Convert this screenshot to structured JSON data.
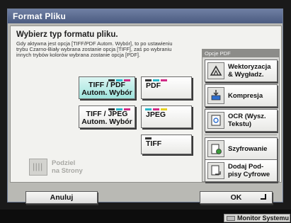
{
  "window": {
    "title": "Format Pliku"
  },
  "heading": "Wybierz typ formatu pliku.",
  "info_lines": [
    "Gdy aktywna jest opcja [TIFF/PDF Autom. Wybór], to po ustawieniu",
    "trybu Czarno-Biały wybrana zostanie opcja [TIFF], zaś po wybraniu",
    "innych trybów kolorów wybrana zostanie opcja [PDF]."
  ],
  "formats": {
    "tiff_pdf": {
      "line1": "TIFF / PDF",
      "line2": "Autom. Wybór",
      "selected": true
    },
    "pdf": {
      "label": "PDF"
    },
    "tiff_jpeg": {
      "line1": "TIFF / JPEG",
      "line2": "Autom. Wybór"
    },
    "jpeg": {
      "label": "JPEG"
    },
    "tiff": {
      "label": "TIFF"
    }
  },
  "split": {
    "line1": "Podziel",
    "line2": "na Strony",
    "enabled": false
  },
  "pdf_options": {
    "title": "Opcje PDF",
    "vector": {
      "line1": "Wektoryzacja",
      "line2": "& Wygładz.",
      "icon": "vectorize-icon"
    },
    "compress": {
      "label": "Kompresja",
      "icon": "compress-icon"
    },
    "ocr": {
      "line1": "OCR (Wysz.",
      "line2": "Tekstu)",
      "icon": "ocr-icon"
    },
    "encrypt": {
      "label": "Szyfrowanie",
      "icon": "encrypt-icon"
    },
    "signature": {
      "line1": "Dodaj Pod-",
      "line2": "pisy Cyfrowe",
      "icon": "signature-icon"
    }
  },
  "buttons": {
    "cancel": "Anuluj",
    "ok": "OK"
  },
  "status": {
    "monitor": "Monitor Systemu"
  },
  "colors": {
    "selected": "#9fe3dc",
    "titlebar": "#4b5b80"
  }
}
